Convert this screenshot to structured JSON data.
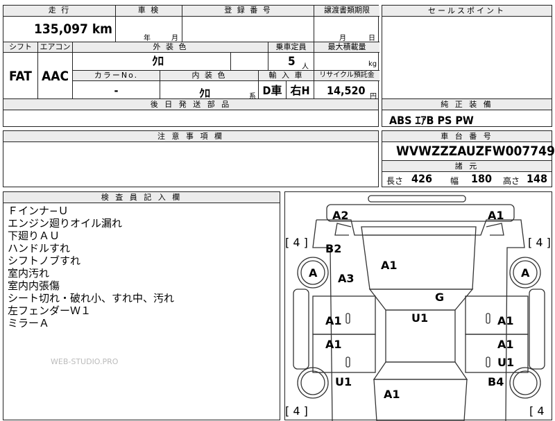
{
  "top_row": {
    "mileage_label": "走 行",
    "inspection_label": "車 検",
    "registration_label": "登 録 番 号",
    "transfer_label": "譲渡書類期限",
    "sales_point_label": "セールスポイント",
    "mileage_value": "135,097 km",
    "inspection_year_unit": "年",
    "inspection_month_unit": "月",
    "transfer_month_unit": "月",
    "transfer_day_unit": "日"
  },
  "row2": {
    "shift_label": "シフト",
    "aircon_label": "エアコン",
    "exterior_label": "外 装 色",
    "capacity_label": "乗車定員",
    "max_load_label": "最大積載量",
    "shift_value": "FAT",
    "aircon_value": "AAC",
    "exterior_value": "ｸﾛ",
    "capacity_value": "5",
    "capacity_unit": "人",
    "max_load_unit": "kg",
    "color_no_label": "カラーNo.",
    "interior_label": "内 装 色",
    "import_label": "輸 入 車",
    "recycle_label": "リサイクル預託金",
    "color_no_value": "-",
    "interior_value": "ｸﾛ",
    "interior_unit": "系",
    "import_value": "D車",
    "steering_value": "右H",
    "recycle_value": "14,520",
    "recycle_unit": "円"
  },
  "delivery_parts_label": "後 日 発 送 部 品",
  "options": {
    "label": "純 正 装 備",
    "value": "ABS ｴｱB PS PW"
  },
  "caution_label": "注 意 事 項 欄",
  "chassis": {
    "label": "車 台 番 号",
    "value": "WVWZZZAUZFW007749"
  },
  "specs": {
    "label": "諸 元",
    "length_label": "長さ",
    "length_value": "426",
    "width_label": "幅",
    "width_value": "180",
    "height_label": "高さ",
    "height_value": "148"
  },
  "inspector": {
    "label": "検 査 員 記 入 欄",
    "notes": [
      "Ｆインナ−Ｕ",
      "エンジン廻りオイル漏れ",
      "下廻りＡＵ",
      "ハンドルすれ",
      "シフトノブすれ",
      "室内汚れ",
      "室内内張傷",
      "シート切れ・破れ小、すれ中、汚れ",
      "左フェンダーＷ１",
      "ミラーＡ"
    ],
    "watermark": "WEB-STUDIO.PRO"
  },
  "diagram_codes": {
    "a2": "A2",
    "a1_tr": "A1",
    "b2": "B2",
    "a1_hood": "A1",
    "a_lf": "A",
    "a_rf": "A",
    "a3": "A3",
    "g": "G",
    "u1_roof": "U1",
    "a1_ld1": "A1",
    "a1_rd1": "A1",
    "a1_ld2": "A1",
    "a1_rd2": "A1",
    "u1_rd2": "U1",
    "u1_lr": "U1",
    "b4": "B4",
    "a1_trunk": "A1",
    "tire_tl": "[ 4 ]",
    "tire_tr": "[ 4 ]",
    "tire_bl": "[ 4 ]",
    "tire_br": "[ 4"
  }
}
